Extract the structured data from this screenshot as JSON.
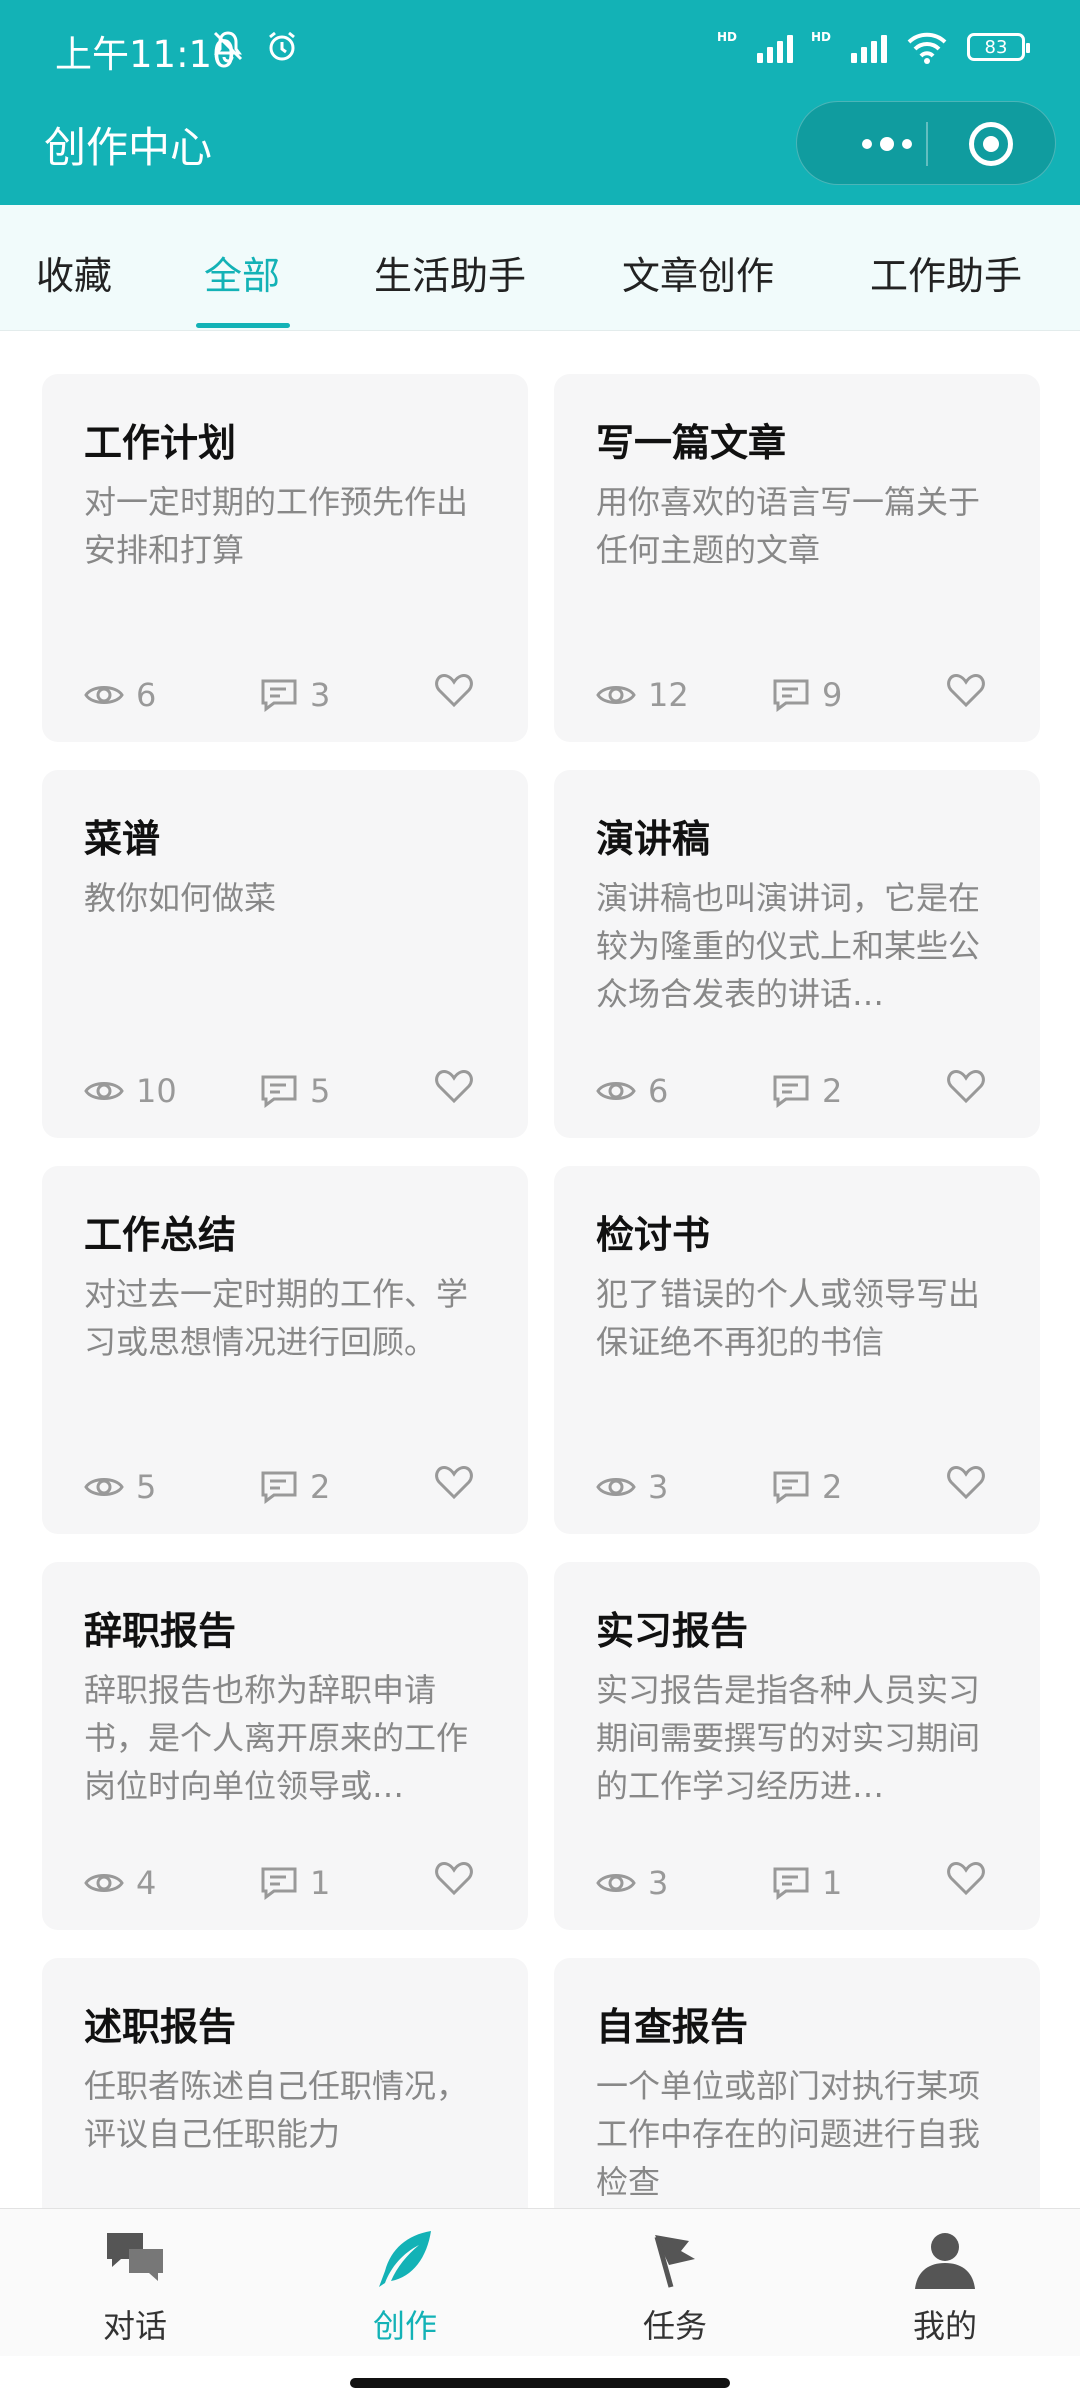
{
  "status": {
    "time": "上午11:10",
    "battery": "83",
    "hd": "HD"
  },
  "header": {
    "title": "创作中心"
  },
  "tabs": [
    "收藏",
    "全部",
    "生活助手",
    "文章创作",
    "工作助手"
  ],
  "active_tab": "全部",
  "cards": [
    {
      "title": "工作计划",
      "desc": "对一定时期的工作预先作出安排和打算",
      "views": "6",
      "comments": "3"
    },
    {
      "title": "写一篇文章",
      "desc": "用你喜欢的语言写一篇关于任何主题的文章",
      "views": "12",
      "comments": "9"
    },
    {
      "title": "菜谱",
      "desc": "教你如何做菜",
      "views": "10",
      "comments": "5"
    },
    {
      "title": "演讲稿",
      "desc": "演讲稿也叫演讲词，它是在较为隆重的仪式上和某些公众场合发表的讲话…",
      "views": "6",
      "comments": "2"
    },
    {
      "title": "工作总结",
      "desc": "对过去一定时期的工作、学习或思想情况进行回顾。",
      "views": "5",
      "comments": "2"
    },
    {
      "title": "检讨书",
      "desc": "犯了错误的个人或领导写出保证绝不再犯的书信",
      "views": "3",
      "comments": "2"
    },
    {
      "title": "辞职报告",
      "desc": "辞职报告也称为辞职申请书，是个人离开原来的工作岗位时向单位领导或…",
      "views": "4",
      "comments": "1"
    },
    {
      "title": "实习报告",
      "desc": "实习报告是指各种人员实习期间需要撰写的对实习期间的工作学习经历进…",
      "views": "3",
      "comments": "1"
    },
    {
      "title": "述职报告",
      "desc": "任职者陈述自己任职情况，评议自己任职能力",
      "views": "",
      "comments": ""
    },
    {
      "title": "自查报告",
      "desc": "一个单位或部门对执行某项工作中存在的问题进行自我检查",
      "views": "",
      "comments": ""
    }
  ],
  "bottom_nav": [
    {
      "label": "对话",
      "icon": "chat-bubbles-icon"
    },
    {
      "label": "创作",
      "icon": "feather-quill-icon"
    },
    {
      "label": "任务",
      "icon": "flag-icon"
    },
    {
      "label": "我的",
      "icon": "user-profile-icon"
    }
  ],
  "colors": {
    "accent": "#13b2b6",
    "card_bg": "#f6f6f7",
    "tab_bg": "#f1fbfb"
  }
}
